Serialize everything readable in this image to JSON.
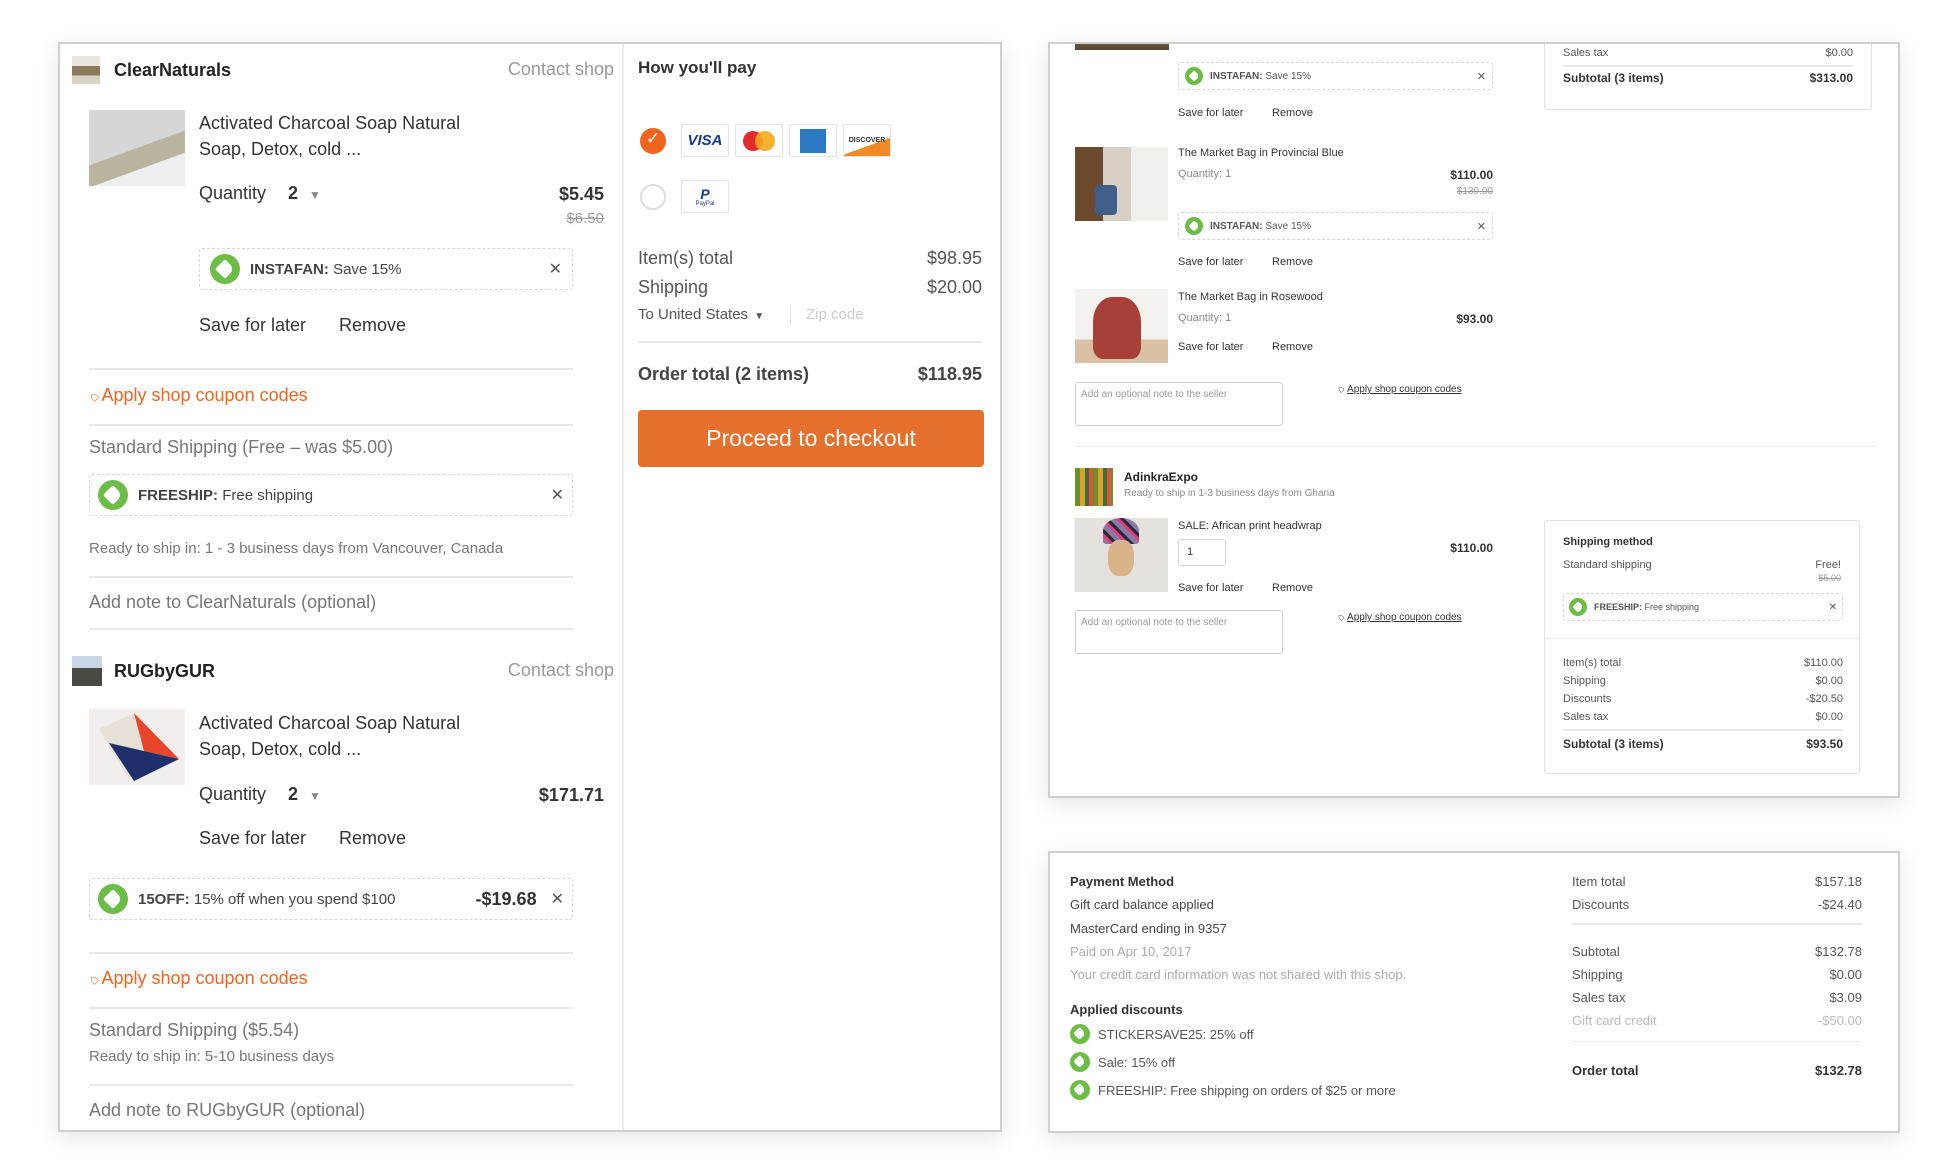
{
  "cart": {
    "shops": [
      {
        "name": "ClearNaturals",
        "contact_label": "Contact shop",
        "item": {
          "title_line1": "Activated Charcoal Soap Natural",
          "title_line2": "Soap, Detox, cold ...",
          "quantity_label": "Quantity",
          "quantity_value": "2",
          "price": "$5.45",
          "original_price": "$6.50",
          "save_for_later": "Save for later",
          "remove": "Remove"
        },
        "coupon": {
          "code": "INSTAFAN:",
          "description": "Save 15%"
        },
        "apply_coupon": "Apply shop coupon codes",
        "shipping": "Standard Shipping (Free – was $5.00)",
        "shipping_coupon": {
          "code": "FREESHIP:",
          "description": "Free shipping"
        },
        "ready_to_ship": "Ready to ship in: 1 - 3 business days from Vancouver, Canada",
        "note_placeholder": "Add note to ClearNaturals (optional)"
      },
      {
        "name": "RUGbyGUR",
        "contact_label": "Contact shop",
        "item": {
          "title_line1": "Activated Charcoal Soap Natural",
          "title_line2": "Soap, Detox, cold ...",
          "quantity_label": "Quantity",
          "quantity_value": "2",
          "price": "$171.71",
          "save_for_later": "Save for later",
          "remove": "Remove"
        },
        "coupon": {
          "code": "15OFF:",
          "description": "15% off when you spend $100",
          "amount": "-$19.68"
        },
        "apply_coupon": "Apply shop coupon codes",
        "shipping": "Standard Shipping ($5.54)",
        "ready_to_ship": "Ready to ship in: 5-10 business days",
        "note_placeholder": "Add note to RUGbyGUR (optional)"
      }
    ],
    "payment": {
      "title": "How you'll pay",
      "methods": [
        {
          "name": "credit-card",
          "selected": true,
          "cards": [
            "VISA",
            "MasterCard",
            "AMEX",
            "DISCOVER"
          ]
        },
        {
          "name": "paypal",
          "selected": false,
          "cards": [
            "PayPal"
          ]
        }
      ],
      "items_total_label": "Item(s) total",
      "items_total": "$98.95",
      "shipping_label": "Shipping",
      "shipping": "$20.00",
      "destination": "To United States",
      "zip_placeholder": "Zip code",
      "order_total_label": "Order total (2 items)",
      "order_total": "$118.95",
      "checkout_button": "Proceed to checkout",
      "accent_color": "#f1641e"
    }
  },
  "multi_shop": {
    "top_partial": {
      "coupon": {
        "code": "INSTAFAN:",
        "description": "Save 15%"
      },
      "save_for_later": "Save for later",
      "remove": "Remove"
    },
    "items": [
      {
        "title": "The Market Bag in Provincial Blue",
        "quantity": "Quantity: 1",
        "price": "$110.00",
        "original_price": "$130.00",
        "coupon": {
          "code": "INSTAFAN:",
          "description": "Save 15%"
        },
        "save_for_later": "Save for later",
        "remove": "Remove"
      },
      {
        "title": "The Market Bag in Rosewood",
        "quantity": "Quantity: 1",
        "price": "$93.00",
        "save_for_later": "Save for later",
        "remove": "Remove"
      }
    ],
    "note_placeholder": "Add an optional note to the seller",
    "apply_coupon": "Apply shop coupon codes",
    "summary_top": {
      "sales_tax_label": "Sales tax",
      "sales_tax": "$0.00",
      "subtotal_label": "Subtotal (3 items)",
      "subtotal": "$313.00"
    },
    "shop2": {
      "name": "AdinkraExpo",
      "ready": "Ready to ship in 1-3 business days from Ghana",
      "item": {
        "title": "SALE: African print headwrap",
        "quantity": "1",
        "price": "$110.00",
        "save_for_later": "Save for later",
        "remove": "Remove"
      },
      "note_placeholder": "Add an optional note to the seller",
      "apply_coupon": "Apply shop coupon codes",
      "summary": {
        "shipping_method_label": "Shipping method",
        "standard_shipping": "Standard shipping",
        "free_label": "Free!",
        "was_price": "$5.00",
        "coupon": {
          "code": "FREESHIP:",
          "description": "Free shipping"
        },
        "rows": [
          {
            "label": "Item(s) total",
            "value": "$110.00"
          },
          {
            "label": "Shipping",
            "value": "$0.00"
          },
          {
            "label": "Discounts",
            "value": "-$20.50"
          },
          {
            "label": "Sales tax",
            "value": "$0.00"
          }
        ],
        "subtotal_label": "Subtotal (3 items)",
        "subtotal": "$93.50"
      }
    }
  },
  "receipt": {
    "payment_method_title": "Payment Method",
    "lines": [
      "Gift card balance applied",
      "MasterCard ending in 9357"
    ],
    "paid_on": "Paid on Apr 10, 2017",
    "privacy_note": "Your credit card information was not shared with this shop.",
    "discounts_title": "Applied discounts",
    "discounts": [
      "STICKERSAVE25: 25% off",
      "Sale: 15% off",
      "FREESHIP: Free shipping on orders of $25 or more"
    ],
    "totals_a": [
      {
        "label": "Item total",
        "value": "$157.18"
      },
      {
        "label": "Discounts",
        "value": "-$24.40"
      }
    ],
    "totals_b": [
      {
        "label": "Subtotal",
        "value": "$132.78"
      },
      {
        "label": "Shipping",
        "value": "$0.00"
      },
      {
        "label": "Sales tax",
        "value": "$3.09"
      },
      {
        "label": "Gift card credit",
        "value": "-$50.00"
      }
    ],
    "order_total_label": "Order total",
    "order_total": "$132.78"
  }
}
